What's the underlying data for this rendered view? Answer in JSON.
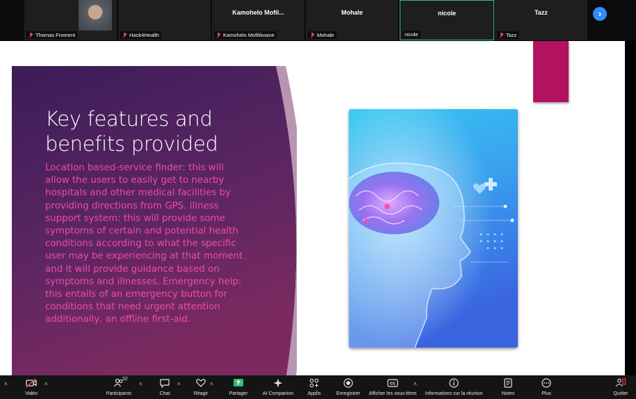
{
  "participants": [
    {
      "tile_name": "",
      "label": "Thomas Froment",
      "has_video": true
    },
    {
      "tile_name": "",
      "label": "Hack4Health",
      "has_video": true
    },
    {
      "tile_name": "Kamohelo  Mofil...",
      "label": "Kamohelo Mofilikoane",
      "has_video": false
    },
    {
      "tile_name": "Mohale",
      "label": "Mohale",
      "has_video": false
    },
    {
      "tile_name": "nicole",
      "label": "nicole",
      "has_video": false,
      "active_speaker": true
    },
    {
      "tile_name": "Tazz",
      "label": "Tazz",
      "has_video": false
    }
  ],
  "strip": {
    "next_icon": "chevron-right-icon"
  },
  "slide": {
    "title": "Key features and benefits provided",
    "body": "Location based-service finder: this will allow the users to easily get to nearby hospitals and other medical facilities by providing directions from GPS. illness support system: this will provide some symptoms of certain and potential health conditions according to what the specific user may be experiencing at that moment and it will provide guidance based on symptoms and illnesses.   Emergency help: this entails of an emergency button for conditions that need urgent attention additionally, an offline first-aid.",
    "colors": {
      "panel_top": "#3b1d57",
      "panel_bottom": "#7a2a60",
      "body_text": "#f04aa8",
      "accent": "#b3125f"
    }
  },
  "toolbar": {
    "video": "Vidéo",
    "participants": "Participants",
    "participants_count": "32",
    "chat": "Chat",
    "react": "Réagir",
    "share": "Partager",
    "ai": "AI Companion",
    "apps": "Applis",
    "record": "Enregistrer",
    "captions": "Afficher les sous-titres",
    "info": "Informations sur la réunion",
    "notes": "Notes",
    "more": "Plus",
    "quit": "Quitter",
    "colors": {
      "share_green": "#2fbf71",
      "danger_red": "#e04848"
    }
  }
}
